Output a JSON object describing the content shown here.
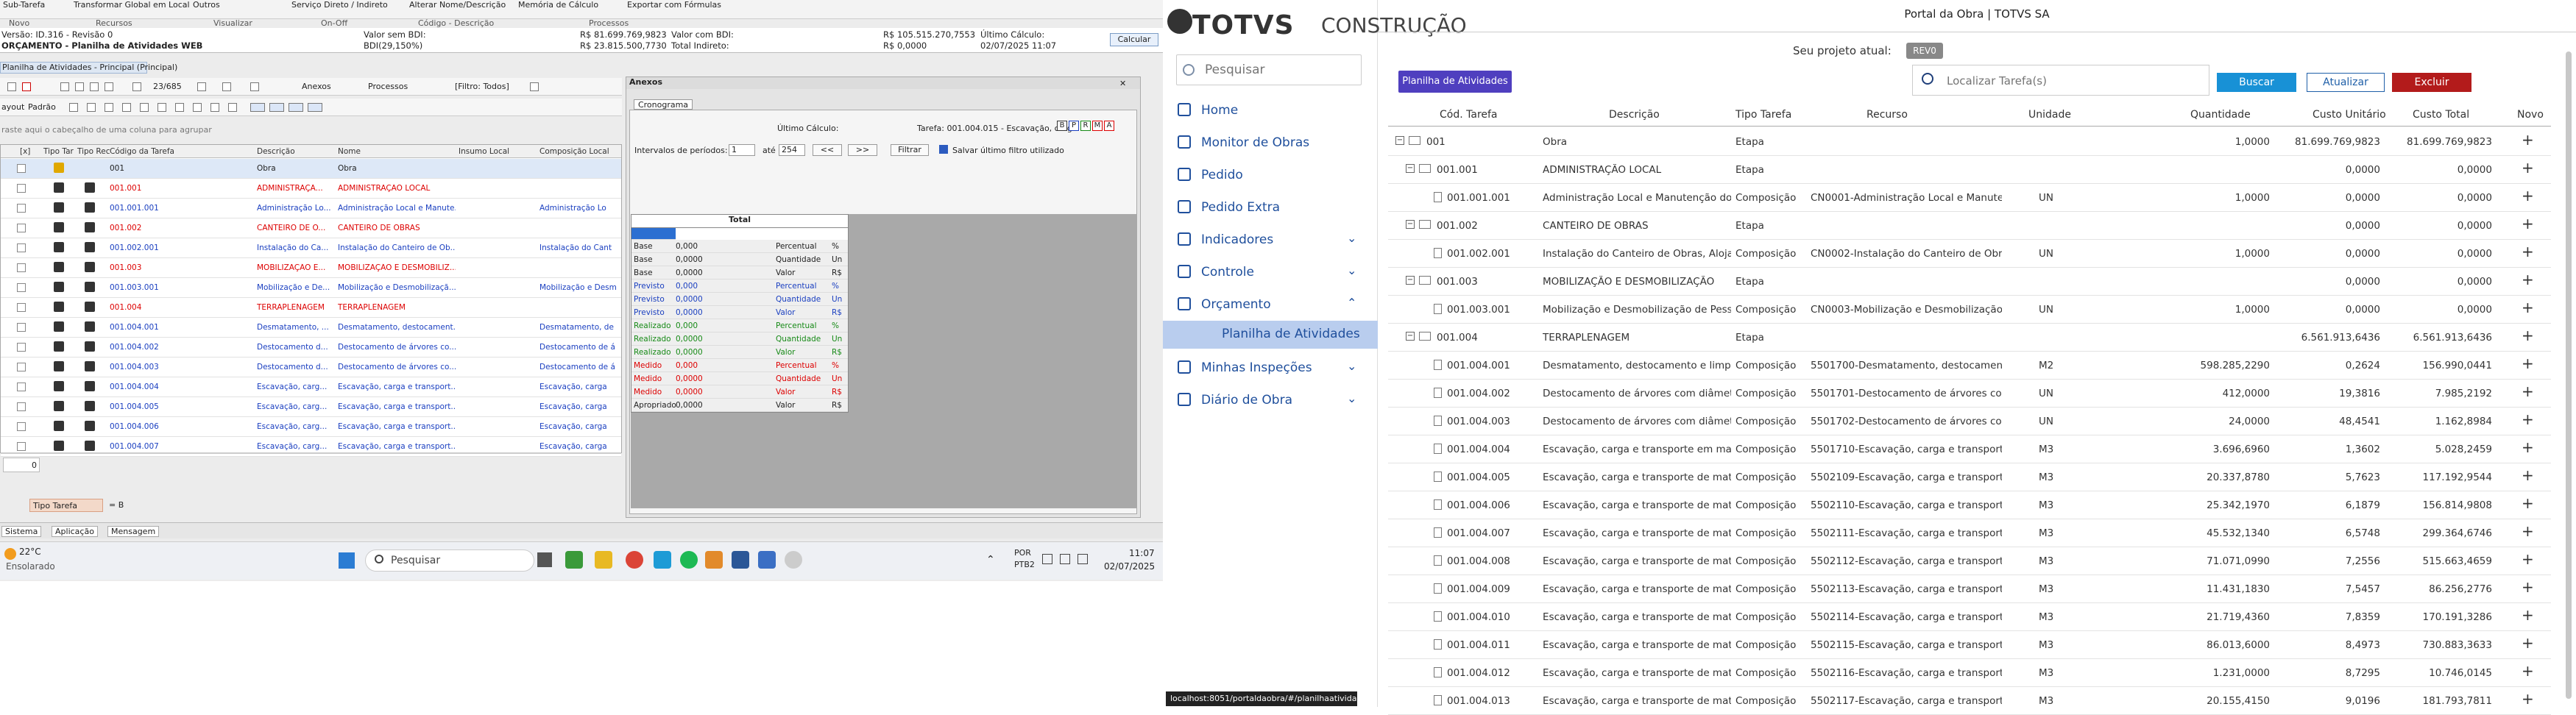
{
  "desktop": {
    "ribbon_top": [
      "Sub-Tarefa",
      "Transformar Global em Local",
      "Outros",
      "Serviço Direto / Indireto",
      "Alterar Nome/Descrição",
      "Memória de Cálculo",
      "Exportar com Fórmulas"
    ],
    "ribbon_groups": [
      "Novo",
      "Recursos",
      "Visualizar",
      "On-Off",
      "Código - Descrição",
      "Processos"
    ],
    "info": {
      "line1_left": "Versão: ID.316 - Revisão 0",
      "line2_left": "ORÇAMENTO - Planilha de Atividades WEB",
      "valor_sem_bdi_label": "Valor sem BDI:",
      "bdi_label": "BDI(29,150%)",
      "valor_sem_bdi": "R$ 81.699.769,9823",
      "bdi_value": "R$ 23.815.500,7730",
      "valor_com_bdi_label": "Valor com BDI:",
      "total_indireto_label": "Total Indireto:",
      "valor_com_bdi": "R$ 105.515.270,7553",
      "total_indireto": "R$ 0,0000",
      "ultimo_calculo_label": "Último Cálculo:",
      "ultimo_calculo": "02/07/2025 11:07",
      "calcular": "Calcular"
    },
    "tab_label": "Planilha de Atividades - Principal (Principal)",
    "toolbar": {
      "count": "23/685",
      "anexos": "Anexos",
      "processos": "Processos",
      "filtro": "[Filtro: Todos]",
      "layout": "ayout",
      "padrao": "Padrão"
    },
    "group_hint": "raste aqui o cabeçalho de uma coluna para agrupar",
    "grid_headers": [
      "[x]",
      "Tipo Tar",
      "Tipo Rec",
      "Código da Tarefa",
      "Descrição",
      "Nome",
      "Insumo Local",
      "Composição Local"
    ],
    "grid_rows": [
      {
        "code": "001",
        "desc": "Obra",
        "name": "Obra",
        "comp": "",
        "color": "black"
      },
      {
        "code": "001.001",
        "desc": "ADMINISTRAÇÃ...",
        "name": "ADMINISTRAÇÃO LOCAL",
        "comp": "",
        "color": "red"
      },
      {
        "code": "001.001.001",
        "desc": "Administração Lo...",
        "name": "Administração Local e Manute...",
        "comp": "Administração Lo",
        "color": "blue"
      },
      {
        "code": "001.002",
        "desc": "CANTEIRO DE O...",
        "name": "CANTEIRO DE OBRAS",
        "comp": "",
        "color": "red"
      },
      {
        "code": "001.002.001",
        "desc": "Instalação do Ca...",
        "name": "Instalação do Canteiro de Ob...",
        "comp": "Instalação do Cant",
        "color": "blue"
      },
      {
        "code": "001.003",
        "desc": "MOBILIZAÇÃO E...",
        "name": "MOBILIZAÇÃO E DESMOBILIZ...",
        "comp": "",
        "color": "red"
      },
      {
        "code": "001.003.001",
        "desc": "Mobilização e De...",
        "name": "Mobilização e Desmobilizaçã...",
        "comp": "Mobilização e Desm",
        "color": "blue"
      },
      {
        "code": "001.004",
        "desc": "TERRAPLENAGEM",
        "name": "TERRAPLENAGEM",
        "comp": "",
        "color": "red"
      },
      {
        "code": "001.004.001",
        "desc": "Desmatamento, ...",
        "name": "Desmatamento, destocament...",
        "comp": "Desmatamento, de",
        "color": "blue"
      },
      {
        "code": "001.004.002",
        "desc": "Destocamento d...",
        "name": "Destocamento de árvores co...",
        "comp": "Destocamento de á",
        "color": "blue"
      },
      {
        "code": "001.004.003",
        "desc": "Destocamento d...",
        "name": "Destocamento de árvores co...",
        "comp": "Destocamento de á",
        "color": "blue"
      },
      {
        "code": "001.004.004",
        "desc": "Escavação, carg...",
        "name": "Escavação, carga e transport...",
        "comp": "Escavação, carga",
        "color": "blue"
      },
      {
        "code": "001.004.005",
        "desc": "Escavação, carg...",
        "name": "Escavação, carga e transport...",
        "comp": "Escavação, carga",
        "color": "blue"
      },
      {
        "code": "001.004.006",
        "desc": "Escavação, carg...",
        "name": "Escavação, carga e transport...",
        "comp": "Escavação, carga",
        "color": "blue"
      },
      {
        "code": "001.004.007",
        "desc": "Escavação, carg...",
        "name": "Escavação, carga e transport...",
        "comp": "Escavação, carga",
        "color": "blue"
      }
    ],
    "grid_footer_value": "0",
    "filter_chip": "Tipo Tarefa",
    "filter_eq": "= B",
    "anexos": {
      "title": "Anexos",
      "tab": "Cronograma",
      "ultimo_calculo_label": "Último Cálculo:",
      "tarefa_label": "Tarefa: 001.004.015 - Escavação, carga",
      "intervalo_label": "Intervalos de períodos:",
      "intervalo_from": "1",
      "ate_label": "até",
      "intervalo_to": "254",
      "prev": "<<",
      "next": ">>",
      "filtrar": "Filtrar",
      "salvar": "Salvar último filtro utilizado",
      "badges": [
        "B",
        "P",
        "R",
        "M",
        "A"
      ],
      "total_title": "Total",
      "total_rows": [
        {
          "label": "Base",
          "value": "0,000",
          "kind": "Percentual",
          "unit": "%",
          "color": "black"
        },
        {
          "label": "Base",
          "value": "0,0000",
          "kind": "Quantidade",
          "unit": "Un",
          "color": "black"
        },
        {
          "label": "Base",
          "value": "0,0000",
          "kind": "Valor",
          "unit": "R$",
          "color": "black"
        },
        {
          "label": "Previsto",
          "value": "0,000",
          "kind": "Percentual",
          "unit": "%",
          "color": "blue"
        },
        {
          "label": "Previsto",
          "value": "0,0000",
          "kind": "Quantidade",
          "unit": "Un",
          "color": "blue"
        },
        {
          "label": "Previsto",
          "value": "0,0000",
          "kind": "Valor",
          "unit": "R$",
          "color": "blue"
        },
        {
          "label": "Realizado",
          "value": "0,000",
          "kind": "Percentual",
          "unit": "%",
          "color": "green"
        },
        {
          "label": "Realizado",
          "value": "0,0000",
          "kind": "Quantidade",
          "unit": "Un",
          "color": "green"
        },
        {
          "label": "Realizado",
          "value": "0,0000",
          "kind": "Valor",
          "unit": "R$",
          "color": "green"
        },
        {
          "label": "Medido",
          "value": "0,000",
          "kind": "Percentual",
          "unit": "%",
          "color": "red"
        },
        {
          "label": "Medido",
          "value": "0,0000",
          "kind": "Quantidade",
          "unit": "Un",
          "color": "red"
        },
        {
          "label": "Medido",
          "value": "0,0000",
          "kind": "Valor",
          "unit": "R$",
          "color": "red"
        },
        {
          "label": "Apropriado",
          "value": "0,0000",
          "kind": "Valor",
          "unit": "R$",
          "color": "black"
        }
      ]
    },
    "bottom_tabs": [
      "Sistema",
      "Aplicação",
      "Mensagem"
    ],
    "taskbar": {
      "weather_temp": "22°C",
      "weather_desc": "Ensolarado",
      "search_placeholder": "Pesquisar",
      "lang1": "POR",
      "lang2": "PTB2",
      "time": "11:07",
      "date": "02/07/2025"
    }
  },
  "portal": {
    "logo": "TOTVS",
    "logo_sub": "CONSTRUÇÃO",
    "title": "Portal da Obra | TOTVS SA",
    "side_search_placeholder": "Pesquisar",
    "nav": [
      {
        "label": "Home",
        "icon": "home-icon",
        "chevron": ""
      },
      {
        "label": "Monitor de Obras",
        "icon": "map-pin-icon",
        "chevron": ""
      },
      {
        "label": "Pedido",
        "icon": "document-icon",
        "chevron": ""
      },
      {
        "label": "Pedido Extra",
        "icon": "document-icon",
        "chevron": ""
      },
      {
        "label": "Indicadores",
        "icon": "chart-icon",
        "chevron": "⌄"
      },
      {
        "label": "Controle",
        "icon": "edit-icon",
        "chevron": "⌄"
      },
      {
        "label": "Orçamento",
        "icon": "dollar-icon",
        "chevron": "⌃"
      }
    ],
    "nav_sub_active": "Planilha de Atividades",
    "nav_after": [
      {
        "label": "Minhas Inspeções",
        "icon": "checklist-icon",
        "chevron": "⌄"
      },
      {
        "label": "Diário de Obra",
        "icon": "calendar-icon",
        "chevron": "⌄"
      }
    ],
    "url_tooltip": "localhost:8051/portaldaobra/#/planilhaatividades",
    "project_label": "Seu projeto atual:",
    "project_badge": "REV0",
    "planilha_button": "Planilha de Atividades",
    "find_placeholder": "Localizar Tarefa(s)",
    "buscar": "Buscar",
    "atualizar": "Atualizar",
    "excluir": "Excluir",
    "columns": [
      "Cód. Tarefa",
      "Descrição",
      "Tipo Tarefa",
      "Recurso",
      "Unidade",
      "Quantidade",
      "Custo Unitário",
      "Custo Total",
      "Novo"
    ],
    "rows": [
      {
        "level": 0,
        "code": "001",
        "desc": "Obra",
        "tipo": "Etapa",
        "recurso": "",
        "un": "",
        "qtd": "1,0000",
        "cu": "81.699.769,9823",
        "ct": "81.699.769,9823"
      },
      {
        "level": 1,
        "code": "001.001",
        "desc": "ADMINISTRAÇÃO LOCAL",
        "tipo": "Etapa",
        "recurso": "",
        "un": "",
        "qtd": "",
        "cu": "0,0000",
        "ct": "0,0000"
      },
      {
        "level": 2,
        "code": "001.001.001",
        "desc": "Administração Local e Manutenção do Ca",
        "tipo": "Composição",
        "recurso": "CN0001-Administração Local e Manuteng",
        "un": "UN",
        "qtd": "1,0000",
        "cu": "0,0000",
        "ct": "0,0000"
      },
      {
        "level": 1,
        "code": "001.002",
        "desc": "CANTEIRO DE OBRAS",
        "tipo": "Etapa",
        "recurso": "",
        "un": "",
        "qtd": "",
        "cu": "0,0000",
        "ct": "0,0000"
      },
      {
        "level": 2,
        "code": "001.002.001",
        "desc": "Instalação do Canteiro de Obras, Alojamer",
        "tipo": "Composição",
        "recurso": "CN0002-Instalação do Canteiro de Obras,",
        "un": "UN",
        "qtd": "1,0000",
        "cu": "0,0000",
        "ct": "0,0000"
      },
      {
        "level": 1,
        "code": "001.003",
        "desc": "MOBILIZAÇÃO E DESMOBILIZAÇÃO",
        "tipo": "Etapa",
        "recurso": "",
        "un": "",
        "qtd": "",
        "cu": "0,0000",
        "ct": "0,0000"
      },
      {
        "level": 2,
        "code": "001.003.001",
        "desc": "Mobilização e Desmobilização de Pessoal ·",
        "tipo": "Composição",
        "recurso": "CN0003-Mobilização e Desmobilização de",
        "un": "UN",
        "qtd": "1,0000",
        "cu": "0,0000",
        "ct": "0,0000"
      },
      {
        "level": 1,
        "code": "001.004",
        "desc": "TERRAPLENAGEM",
        "tipo": "Etapa",
        "recurso": "",
        "un": "",
        "qtd": "",
        "cu": "6.561.913,6436",
        "ct": "6.561.913,6436"
      },
      {
        "level": 2,
        "code": "001.004.001",
        "desc": "Desmatamento, destocamento e limpeza c",
        "tipo": "Composição",
        "recurso": "5501700-Desmatamento, destocamento e",
        "un": "M2",
        "qtd": "598.285,2290",
        "cu": "0,2624",
        "ct": "156.990,0441"
      },
      {
        "level": 2,
        "code": "001.004.002",
        "desc": "Destocamento de árvores com diâmetro d",
        "tipo": "Composição",
        "recurso": "5501701-Destocamento de árvores com c",
        "un": "UN",
        "qtd": "412,0000",
        "cu": "19,3816",
        "ct": "7.985,2192"
      },
      {
        "level": 2,
        "code": "001.004.003",
        "desc": "Destocamento de árvores com diâmetro m",
        "tipo": "Composição",
        "recurso": "5501702-Destocamento de árvores com c",
        "un": "UN",
        "qtd": "24,0000",
        "cu": "48,4541",
        "ct": "1.162,8984"
      },
      {
        "level": 2,
        "code": "001.004.004",
        "desc": "Escavação, carga e transporte em material",
        "tipo": "Composição",
        "recurso": "5501710-Escavação, carga e transporte e",
        "un": "M3",
        "qtd": "3.696,6960",
        "cu": "1,3602",
        "ct": "5.028,2459"
      },
      {
        "level": 2,
        "code": "001.004.005",
        "desc": "Escavação, carga e transporte de material",
        "tipo": "Composição",
        "recurso": "5502109-Escavação, carga e transporte d",
        "un": "M3",
        "qtd": "20.337,8780",
        "cu": "5,7623",
        "ct": "117.192,9544"
      },
      {
        "level": 2,
        "code": "001.004.006",
        "desc": "Escavação, carga e transporte de material",
        "tipo": "Composição",
        "recurso": "5502110-Escavação, carga e transporte d",
        "un": "M3",
        "qtd": "25.342,1970",
        "cu": "6,1879",
        "ct": "156.814,9808"
      },
      {
        "level": 2,
        "code": "001.004.007",
        "desc": "Escavação, carga e transporte de material",
        "tipo": "Composição",
        "recurso": "5502111-Escavação, carga e transporte d",
        "un": "M3",
        "qtd": "45.532,1340",
        "cu": "6,5748",
        "ct": "299.364,6746"
      },
      {
        "level": 2,
        "code": "001.004.008",
        "desc": "Escavação, carga e transporte de material",
        "tipo": "Composição",
        "recurso": "5502112-Escavação, carga e transporte d",
        "un": "M3",
        "qtd": "71.071,0990",
        "cu": "7,2556",
        "ct": "515.663,4659"
      },
      {
        "level": 2,
        "code": "001.004.009",
        "desc": "Escavação, carga e transporte de material",
        "tipo": "Composição",
        "recurso": "5502113-Escavação, carga e transporte d",
        "un": "M3",
        "qtd": "11.431,1830",
        "cu": "7,5457",
        "ct": "86.256,2776"
      },
      {
        "level": 2,
        "code": "001.004.010",
        "desc": "Escavação, carga e transporte de material",
        "tipo": "Composição",
        "recurso": "5502114-Escavação, carga e transporte d",
        "un": "M3",
        "qtd": "21.719,4360",
        "cu": "7,8359",
        "ct": "170.191,3286"
      },
      {
        "level": 2,
        "code": "001.004.011",
        "desc": "Escavação, carga e transporte de material",
        "tipo": "Composição",
        "recurso": "5502115-Escavação, carga e transporte d",
        "un": "M3",
        "qtd": "86.013,6000",
        "cu": "8,4973",
        "ct": "730.883,3633"
      },
      {
        "level": 2,
        "code": "001.004.012",
        "desc": "Escavação, carga e transporte de material",
        "tipo": "Composição",
        "recurso": "5502116-Escavação, carga e transporte d",
        "un": "M3",
        "qtd": "1.231,0000",
        "cu": "8,7295",
        "ct": "10.746,0145"
      },
      {
        "level": 2,
        "code": "001.004.013",
        "desc": "Escavação, carga e transporte de material",
        "tipo": "Composição",
        "recurso": "5502117-Escavação, carga e transporte d",
        "un": "M3",
        "qtd": "20.155,4150",
        "cu": "9,0196",
        "ct": "181.793,7811"
      }
    ]
  }
}
